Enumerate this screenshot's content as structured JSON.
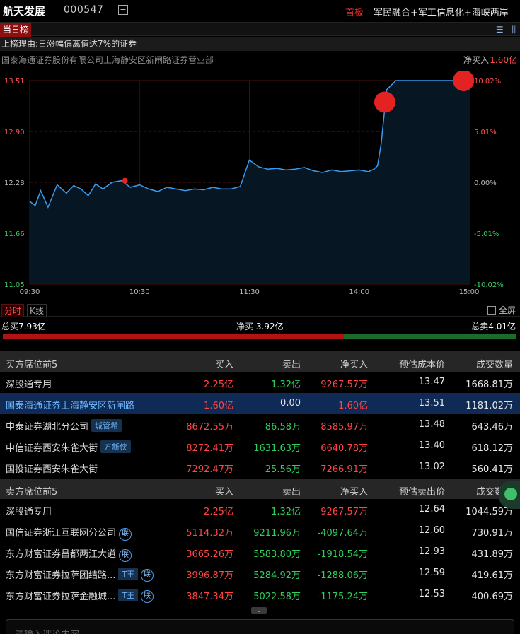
{
  "header": {
    "stock_name": "航天发展",
    "stock_code": "000547",
    "toggle_symbol": "−",
    "board_label": "首板",
    "concepts": "军民融合+军工信息化+海峡两岸"
  },
  "tabs": {
    "day_list": "当日榜",
    "list_icon": "list-icon",
    "chart_icon": "bar-chart-icon"
  },
  "reason": "上榜理由:日涨幅偏离值达7%的证券",
  "broker": {
    "name": "国泰海通证券股份有限公司上海静安区新闸路证券营业部",
    "net_buy_label": "净买入",
    "net_buy_value": "1.60亿"
  },
  "chart_data": {
    "type": "line",
    "title": "",
    "y_left_ticks": [
      "13.51",
      "12.90",
      "12.28",
      "11.66",
      "11.05"
    ],
    "y_right_ticks": [
      "10.02%",
      "5.01%",
      "0.00%",
      "-5.01%",
      "-10.02%"
    ],
    "x_ticks": [
      "09:30",
      "10:30",
      "11:30",
      "14:00",
      "15:00"
    ],
    "ylim": [
      11.05,
      13.51
    ],
    "prev_close": 12.28,
    "x_sessions": {
      "minutes_total": 240
    },
    "series": [
      {
        "minute": [
          0,
          3,
          6,
          10,
          15,
          20,
          24,
          28,
          32,
          36,
          40,
          45,
          50,
          55,
          60,
          65,
          70,
          75,
          80,
          85,
          90,
          95,
          100,
          105,
          110,
          115,
          120,
          125,
          130,
          135,
          140,
          145,
          150,
          155,
          160,
          165,
          170,
          175,
          180,
          185,
          188,
          190,
          192,
          193,
          195,
          200,
          210,
          220,
          240
        ],
        "price": [
          12.05,
          12.0,
          12.18,
          11.98,
          12.25,
          12.15,
          12.24,
          12.2,
          12.12,
          12.26,
          12.2,
          12.28,
          12.3,
          12.22,
          12.25,
          12.2,
          12.17,
          12.22,
          12.2,
          12.18,
          12.2,
          12.19,
          12.22,
          12.2,
          12.2,
          12.23,
          12.55,
          12.47,
          12.44,
          12.45,
          12.43,
          12.44,
          12.46,
          12.42,
          12.4,
          12.43,
          12.41,
          12.42,
          12.43,
          12.41,
          12.44,
          12.48,
          12.75,
          12.97,
          13.4,
          13.51,
          13.51,
          13.51,
          13.51
        ]
      }
    ],
    "markers": [
      {
        "minute": 52,
        "price": 12.3,
        "size": "small"
      },
      {
        "minute": 194,
        "price": 13.25,
        "size": "large"
      },
      {
        "minute": 237,
        "price": 13.51,
        "size": "large"
      }
    ],
    "colors": {
      "line": "#3a9cf0",
      "fill": "#061622",
      "marker": "#e52222",
      "grid": "#5a1a1a"
    }
  },
  "modes": {
    "intraday": "分时",
    "kline": "K线",
    "fullscreen": "全屏"
  },
  "summary": {
    "total_buy_label": "总买",
    "total_buy": "7.93亿",
    "net_buy_label": "净买",
    "net_buy": "3.92亿",
    "total_sell_label": "总卖",
    "total_sell": "4.01亿",
    "buy_ratio": 0.664
  },
  "buy_section": {
    "headers": [
      "买方席位前5",
      "买入",
      "卖出",
      "净买入",
      "预估成本价",
      "成交数量"
    ],
    "rows": [
      {
        "name": "深股通专用",
        "tag": "",
        "lian": false,
        "buy": "2.25亿",
        "sell": "1.32亿",
        "net": "9267.57万",
        "price": "13.47",
        "qty": "1668.81万"
      },
      {
        "name": "国泰海通证券上海静安区新闸路",
        "tag": "",
        "lian": false,
        "buy": "1.60亿",
        "sell": "0.00",
        "net": "1.60亿",
        "price": "13.51",
        "qty": "1181.02万"
      },
      {
        "name": "中泰证券湖北分公司",
        "tag": "城管希",
        "lian": false,
        "buy": "8672.55万",
        "sell": "86.58万",
        "net": "8585.97万",
        "price": "13.48",
        "qty": "643.46万"
      },
      {
        "name": "中信证券西安朱雀大街",
        "tag": "方新侠",
        "lian": false,
        "buy": "8272.41万",
        "sell": "1631.63万",
        "net": "6640.78万",
        "price": "13.40",
        "qty": "618.12万"
      },
      {
        "name": "国投证券西安朱雀大街",
        "tag": "",
        "lian": false,
        "buy": "7292.47万",
        "sell": "25.56万",
        "net": "7266.91万",
        "price": "13.02",
        "qty": "560.41万"
      }
    ]
  },
  "sell_section": {
    "headers": [
      "卖方席位前5",
      "买入",
      "卖出",
      "净买入",
      "预估卖出价",
      "成交数量"
    ],
    "rows": [
      {
        "name": "深股通专用",
        "tag": "",
        "lian": false,
        "buy": "2.25亿",
        "sell": "1.32亿",
        "net": "9267.57万",
        "price": "12.64",
        "qty": "1044.59万"
      },
      {
        "name": "国信证券浙江互联网分公司",
        "tag": "",
        "lian": true,
        "buy": "5114.32万",
        "sell": "9211.96万",
        "net": "-4097.64万",
        "price": "12.60",
        "qty": "730.91万"
      },
      {
        "name": "东方财富证券昌都两江大道",
        "tag": "",
        "lian": true,
        "buy": "3665.26万",
        "sell": "5583.80万",
        "net": "-1918.54万",
        "price": "12.93",
        "qty": "431.89万"
      },
      {
        "name": "东方财富证券拉萨团结路...",
        "tag": "T王",
        "lian": true,
        "buy": "3996.87万",
        "sell": "5284.92万",
        "net": "-1288.06万",
        "price": "12.59",
        "qty": "419.61万"
      },
      {
        "name": "东方财富证券拉萨金融城...",
        "tag": "T王",
        "lian": true,
        "buy": "3847.34万",
        "sell": "5022.58万",
        "net": "-1175.24万",
        "price": "12.53",
        "qty": "400.69万"
      }
    ]
  },
  "lian_text": "联",
  "comment_placeholder": "请输入评论内容"
}
